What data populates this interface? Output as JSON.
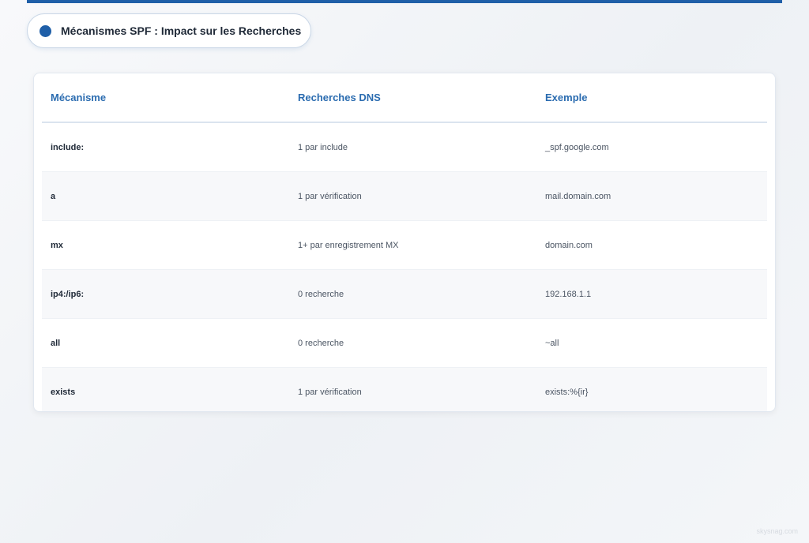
{
  "title": "Mécanismes SPF : Impact sur les Recherches",
  "table": {
    "headers": [
      "Mécanisme",
      "Recherches DNS",
      "Exemple"
    ],
    "rows": [
      {
        "mechanism": "include:",
        "lookups": "1 par include",
        "example": "_spf.google.com"
      },
      {
        "mechanism": "a",
        "lookups": "1 par vérification",
        "example": "mail.domain.com"
      },
      {
        "mechanism": "mx",
        "lookups": "1+ par enregistrement MX",
        "example": "domain.com"
      },
      {
        "mechanism": "ip4:/ip6:",
        "lookups": "0 recherche",
        "example": "192.168.1.1"
      },
      {
        "mechanism": "all",
        "lookups": "0 recherche",
        "example": "~all"
      },
      {
        "mechanism": "exists",
        "lookups": "1 par vérification",
        "example": "exists:%{ir}"
      }
    ]
  },
  "watermark": "skysnag.com",
  "colors": {
    "accent": "#1f5fa8",
    "header_text": "#2b6cb0"
  }
}
